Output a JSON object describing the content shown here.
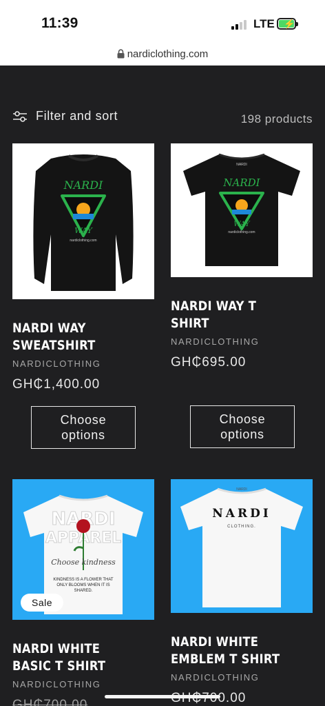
{
  "status": {
    "time": "11:39",
    "network": "LTE"
  },
  "browser": {
    "url": "nardiclothing.com"
  },
  "filter": {
    "label": "Filter and sort",
    "count": "198 products"
  },
  "products": [
    {
      "title": "NARDI WAY\nSWEATSHIRT",
      "vendor": "NARDICLOTHING",
      "price": "GH₵1,400.00",
      "button": "Choose\noptions",
      "print_text": "nardiclothing.com"
    },
    {
      "title": "NARDI WAY T\nSHIRT",
      "vendor": "NARDICLOTHING",
      "price": "GH₵695.00",
      "button": "Choose\noptions",
      "print_text": "nardiclothing.com",
      "tag_text": "NARDI"
    },
    {
      "title": "NARDI WHITE\nBASIC T SHIRT",
      "vendor": "NARDICLOTHING",
      "price": "GH₵700.00",
      "badge": "Sale",
      "print_text": "KINDNESS IS A FLOWER THAT\nONLY BLOOMS WHEN IT IS\nSHARED."
    },
    {
      "title": "NARDI WHITE\nEMBLEM T SHIRT",
      "vendor": "NARDICLOTHING",
      "price": "GH₵700.00",
      "logo_text": "NARDI",
      "logo_sub": "CLOTHING.",
      "tag_text": "NARDI"
    }
  ],
  "colors": {
    "page_bg": "#1f1f21",
    "card_blue": "#29a9f4",
    "print_green": "#2bb24c"
  }
}
